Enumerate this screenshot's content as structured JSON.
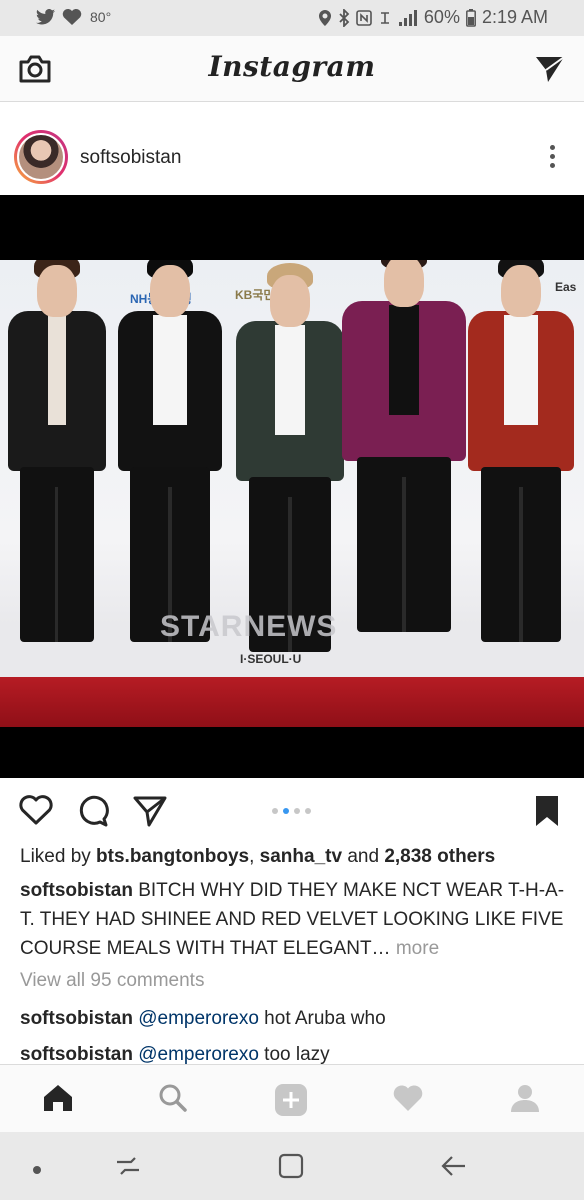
{
  "status_bar": {
    "temperature": "80°",
    "battery_percent": "60%",
    "time": "2:19 AM"
  },
  "header": {
    "logo_text": "Instagram",
    "camera_icon": "camera-icon",
    "direct_icon": "paper-plane-icon"
  },
  "post": {
    "username": "softsobistan",
    "photo_watermark": "STARNEWS",
    "photo_sponsors": [
      "NH농협은행",
      "KB국민은행",
      "I·SEOUL·U",
      "Eas"
    ],
    "carousel": {
      "count": 4,
      "active_index": 1
    },
    "likes": {
      "prefix": "Liked by ",
      "user1": "bts.bangtonboys",
      "separator": ", ",
      "user2": "sanha_tv",
      "and": " and ",
      "others": "2,838 others"
    },
    "caption": {
      "username": "softsobistan",
      "text": " BITCH WHY DID THEY MAKE NCT WEAR T-H-A-T. THEY HAD SHINEE AND RED VELVET LOOKING LIKE FIVE COURSE MEALS WITH THAT ELEGANT…",
      "more": " more"
    },
    "view_all_comments": "View all 95 comments",
    "comments": [
      {
        "username": "softsobistan",
        "mention": "@emperorexo",
        "text": " hot Aruba who"
      },
      {
        "username": "softsobistan",
        "mention": "@emperorexo",
        "text": " too lazy"
      }
    ]
  },
  "bottom_nav": [
    "home-icon",
    "search-icon",
    "add-post-icon",
    "heart-icon",
    "profile-icon"
  ],
  "colors": {
    "accent_blue": "#3897f0",
    "gradient_ring": "#e1306c",
    "text_primary": "#262626",
    "text_muted": "#999999"
  }
}
